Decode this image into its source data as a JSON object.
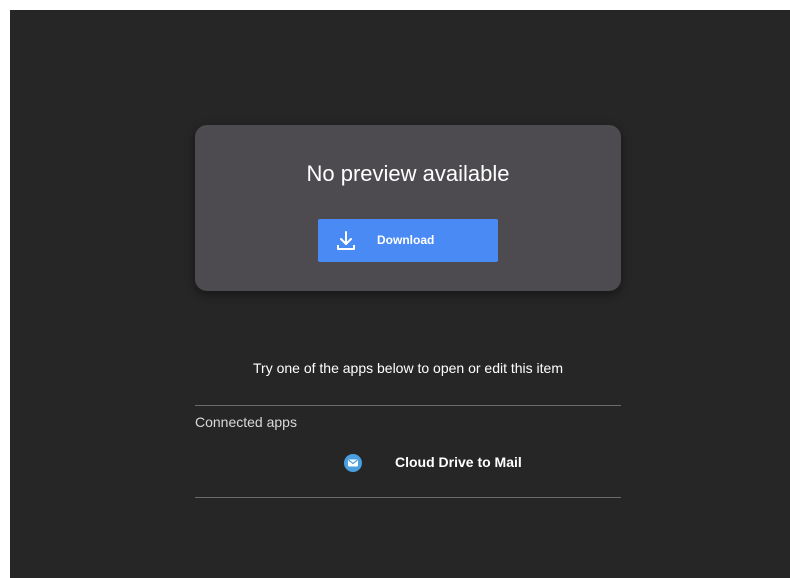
{
  "preview": {
    "message": "No preview available",
    "download_label": "Download",
    "download_icon": "download-icon",
    "accent_color": "#4a8af4"
  },
  "hint": "Try one of the apps below to open or edit this item",
  "connected_apps": {
    "section_label": "Connected apps",
    "items": [
      {
        "label": "Cloud Drive to Mail",
        "icon": "mail-icon",
        "icon_color": "#4a9fe0"
      }
    ]
  },
  "colors": {
    "background": "#262626",
    "card": "#4d4b4f"
  }
}
